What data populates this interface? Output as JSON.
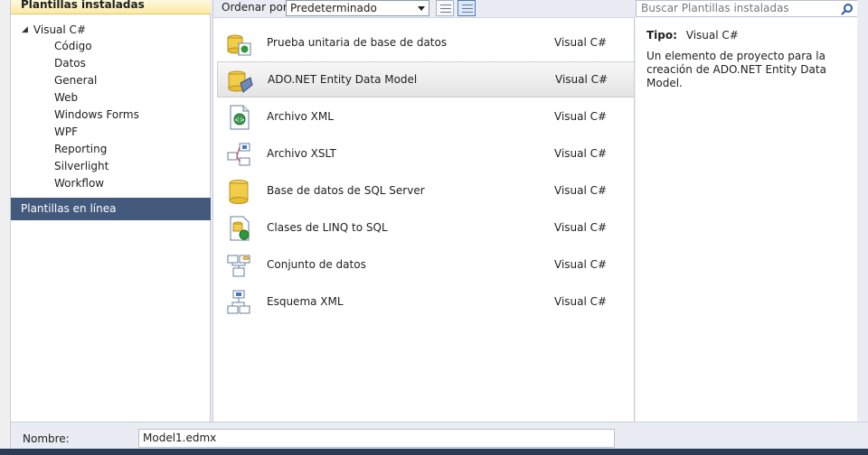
{
  "left": {
    "header": "Plantillas instaladas",
    "root": "Visual C#",
    "items": [
      "Código",
      "Datos",
      "General",
      "Web",
      "Windows Forms",
      "WPF",
      "Reporting",
      "Silverlight",
      "Workflow"
    ],
    "online": "Plantillas en línea"
  },
  "toolbar": {
    "sort_label": "Ordenar por:",
    "sort_value": "Predeterminado"
  },
  "templates": [
    {
      "name": "Prueba unitaria de base de datos",
      "lang": "Visual C#",
      "icon": "unit-test-db-icon"
    },
    {
      "name": "ADO.NET Entity Data Model",
      "lang": "Visual C#",
      "icon": "entity-model-icon"
    },
    {
      "name": "Archivo XML",
      "lang": "Visual C#",
      "icon": "xml-file-icon"
    },
    {
      "name": "Archivo XSLT",
      "lang": "Visual C#",
      "icon": "xslt-file-icon"
    },
    {
      "name": "Base de datos de SQL Server",
      "lang": "Visual C#",
      "icon": "sql-database-icon"
    },
    {
      "name": "Clases de LINQ to SQL",
      "lang": "Visual C#",
      "icon": "linq-to-sql-icon"
    },
    {
      "name": "Conjunto de datos",
      "lang": "Visual C#",
      "icon": "dataset-icon"
    },
    {
      "name": "Esquema XML",
      "lang": "Visual C#",
      "icon": "xml-schema-icon"
    }
  ],
  "right": {
    "search_placeholder": "Buscar Plantillas instaladas",
    "type_label": "Tipo:",
    "type_value": "Visual C#",
    "description": "Un elemento de proyecto para la creación de ADO.NET Entity Data Model."
  },
  "bottom": {
    "name_label": "Nombre:",
    "name_value": "Model1.edmx"
  },
  "colors": {
    "online_bar": "#435a7d",
    "header_gradient": "#fbe9a4",
    "selection": "#e4e4e4"
  }
}
